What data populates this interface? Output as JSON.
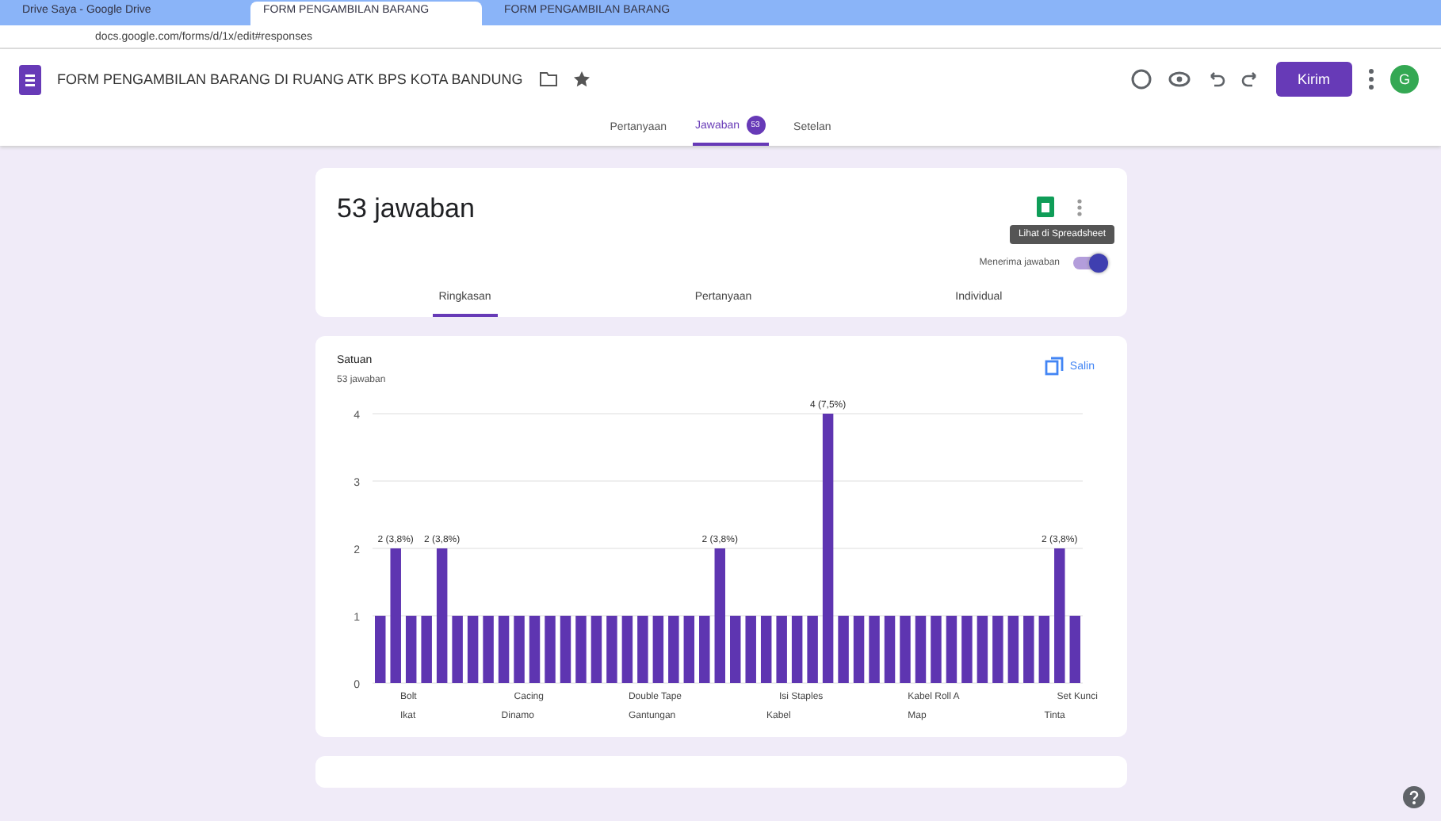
{
  "browser": {
    "tabs": [
      {
        "title": "Drive Saya - Google Drive",
        "selected": false
      },
      {
        "title": "FORM PENGAMBILAN BARANG",
        "selected": true
      },
      {
        "title": "FORM PENGAMBILAN BARANG",
        "selected": false
      }
    ],
    "url": "docs.google.com/forms/d/1x/edit#responses"
  },
  "header": {
    "title": "FORM PENGAMBILAN BARANG DI RUANG ATK BPS KOTA BANDUNG",
    "send_button": "Kirim",
    "avatar": "G"
  },
  "form_tabs": [
    {
      "label": "Pertanyaan",
      "selected": false
    },
    {
      "label": "Jawaban",
      "selected": true,
      "badge": "53"
    },
    {
      "label": "Setelan",
      "selected": false
    }
  ],
  "summary": {
    "count": "53 jawaban",
    "tooltip": "Lihat di Spreadsheet",
    "accepting_label": "Menerima jawaban",
    "accepting": true,
    "tabs": [
      {
        "label": "Ringkasan",
        "selected": true
      },
      {
        "label": "Pertanyaan",
        "selected": false
      },
      {
        "label": "Individual",
        "selected": false
      }
    ]
  },
  "question": {
    "title": "Satuan",
    "responses": "53 jawaban",
    "copy_button": "Salin",
    "x_labels": [
      [
        "Bolt",
        "Ikat"
      ],
      [
        "Cacing",
        "Dinamo"
      ],
      [
        "Double Tape",
        "Gantungan"
      ],
      [
        "Isi Staples",
        "Kabel"
      ],
      [
        "Kabel Roll A",
        "Map"
      ],
      [
        "Set Kunci",
        "Tinta"
      ]
    ],
    "chart_data": {
      "type": "bar",
      "grid": true,
      "yticks": [
        0,
        1,
        2,
        3,
        4
      ],
      "ylim": [
        0,
        4
      ],
      "values": [
        1,
        2,
        1,
        1,
        2,
        1,
        1,
        1,
        1,
        1,
        1,
        1,
        1,
        1,
        1,
        1,
        1,
        1,
        1,
        1,
        1,
        1,
        2,
        1,
        1,
        1,
        1,
        1,
        1,
        4,
        1,
        1,
        1,
        1,
        1,
        1,
        1,
        1,
        1,
        1,
        1,
        1,
        1,
        1,
        2,
        1
      ],
      "value_labels": [
        null,
        "2 (3,8%)",
        null,
        null,
        "2 (3,8%)",
        null,
        null,
        null,
        null,
        null,
        null,
        null,
        null,
        null,
        null,
        null,
        null,
        null,
        null,
        null,
        null,
        null,
        "2 (3,8%)",
        null,
        null,
        null,
        null,
        null,
        null,
        "4 (7,5%)",
        null,
        null,
        null,
        null,
        null,
        null,
        null,
        null,
        null,
        null,
        null,
        null,
        null,
        null,
        "2 (3,8%)",
        null
      ]
    }
  }
}
